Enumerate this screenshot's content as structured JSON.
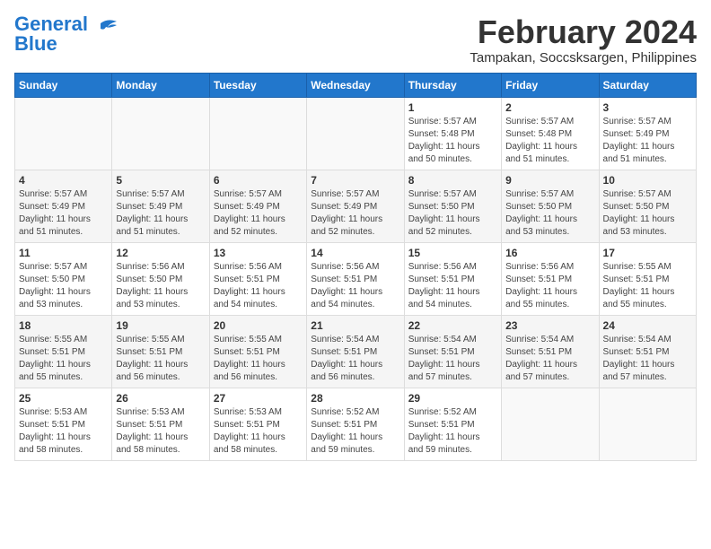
{
  "header": {
    "logo_line1": "General",
    "logo_line2": "Blue",
    "title": "February 2024",
    "subtitle": "Tampakan, Soccsksargen, Philippines"
  },
  "columns": [
    "Sunday",
    "Monday",
    "Tuesday",
    "Wednesday",
    "Thursday",
    "Friday",
    "Saturday"
  ],
  "weeks": [
    [
      {
        "day": "",
        "info": ""
      },
      {
        "day": "",
        "info": ""
      },
      {
        "day": "",
        "info": ""
      },
      {
        "day": "",
        "info": ""
      },
      {
        "day": "1",
        "info": "Sunrise: 5:57 AM\nSunset: 5:48 PM\nDaylight: 11 hours\nand 50 minutes."
      },
      {
        "day": "2",
        "info": "Sunrise: 5:57 AM\nSunset: 5:48 PM\nDaylight: 11 hours\nand 51 minutes."
      },
      {
        "day": "3",
        "info": "Sunrise: 5:57 AM\nSunset: 5:49 PM\nDaylight: 11 hours\nand 51 minutes."
      }
    ],
    [
      {
        "day": "4",
        "info": "Sunrise: 5:57 AM\nSunset: 5:49 PM\nDaylight: 11 hours\nand 51 minutes."
      },
      {
        "day": "5",
        "info": "Sunrise: 5:57 AM\nSunset: 5:49 PM\nDaylight: 11 hours\nand 51 minutes."
      },
      {
        "day": "6",
        "info": "Sunrise: 5:57 AM\nSunset: 5:49 PM\nDaylight: 11 hours\nand 52 minutes."
      },
      {
        "day": "7",
        "info": "Sunrise: 5:57 AM\nSunset: 5:49 PM\nDaylight: 11 hours\nand 52 minutes."
      },
      {
        "day": "8",
        "info": "Sunrise: 5:57 AM\nSunset: 5:50 PM\nDaylight: 11 hours\nand 52 minutes."
      },
      {
        "day": "9",
        "info": "Sunrise: 5:57 AM\nSunset: 5:50 PM\nDaylight: 11 hours\nand 53 minutes."
      },
      {
        "day": "10",
        "info": "Sunrise: 5:57 AM\nSunset: 5:50 PM\nDaylight: 11 hours\nand 53 minutes."
      }
    ],
    [
      {
        "day": "11",
        "info": "Sunrise: 5:57 AM\nSunset: 5:50 PM\nDaylight: 11 hours\nand 53 minutes."
      },
      {
        "day": "12",
        "info": "Sunrise: 5:56 AM\nSunset: 5:50 PM\nDaylight: 11 hours\nand 53 minutes."
      },
      {
        "day": "13",
        "info": "Sunrise: 5:56 AM\nSunset: 5:51 PM\nDaylight: 11 hours\nand 54 minutes."
      },
      {
        "day": "14",
        "info": "Sunrise: 5:56 AM\nSunset: 5:51 PM\nDaylight: 11 hours\nand 54 minutes."
      },
      {
        "day": "15",
        "info": "Sunrise: 5:56 AM\nSunset: 5:51 PM\nDaylight: 11 hours\nand 54 minutes."
      },
      {
        "day": "16",
        "info": "Sunrise: 5:56 AM\nSunset: 5:51 PM\nDaylight: 11 hours\nand 55 minutes."
      },
      {
        "day": "17",
        "info": "Sunrise: 5:55 AM\nSunset: 5:51 PM\nDaylight: 11 hours\nand 55 minutes."
      }
    ],
    [
      {
        "day": "18",
        "info": "Sunrise: 5:55 AM\nSunset: 5:51 PM\nDaylight: 11 hours\nand 55 minutes."
      },
      {
        "day": "19",
        "info": "Sunrise: 5:55 AM\nSunset: 5:51 PM\nDaylight: 11 hours\nand 56 minutes."
      },
      {
        "day": "20",
        "info": "Sunrise: 5:55 AM\nSunset: 5:51 PM\nDaylight: 11 hours\nand 56 minutes."
      },
      {
        "day": "21",
        "info": "Sunrise: 5:54 AM\nSunset: 5:51 PM\nDaylight: 11 hours\nand 56 minutes."
      },
      {
        "day": "22",
        "info": "Sunrise: 5:54 AM\nSunset: 5:51 PM\nDaylight: 11 hours\nand 57 minutes."
      },
      {
        "day": "23",
        "info": "Sunrise: 5:54 AM\nSunset: 5:51 PM\nDaylight: 11 hours\nand 57 minutes."
      },
      {
        "day": "24",
        "info": "Sunrise: 5:54 AM\nSunset: 5:51 PM\nDaylight: 11 hours\nand 57 minutes."
      }
    ],
    [
      {
        "day": "25",
        "info": "Sunrise: 5:53 AM\nSunset: 5:51 PM\nDaylight: 11 hours\nand 58 minutes."
      },
      {
        "day": "26",
        "info": "Sunrise: 5:53 AM\nSunset: 5:51 PM\nDaylight: 11 hours\nand 58 minutes."
      },
      {
        "day": "27",
        "info": "Sunrise: 5:53 AM\nSunset: 5:51 PM\nDaylight: 11 hours\nand 58 minutes."
      },
      {
        "day": "28",
        "info": "Sunrise: 5:52 AM\nSunset: 5:51 PM\nDaylight: 11 hours\nand 59 minutes."
      },
      {
        "day": "29",
        "info": "Sunrise: 5:52 AM\nSunset: 5:51 PM\nDaylight: 11 hours\nand 59 minutes."
      },
      {
        "day": "",
        "info": ""
      },
      {
        "day": "",
        "info": ""
      }
    ]
  ]
}
